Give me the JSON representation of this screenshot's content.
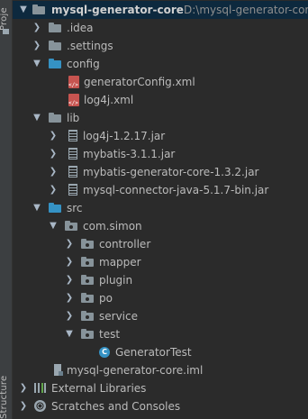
{
  "side_tool_window": {
    "top_label": "Proje",
    "bottom_label": "Structure"
  },
  "tree": {
    "root": {
      "name": "mysql-generator-core",
      "path": "D:\\mysql-generator-cor"
    },
    "idea": ".idea",
    "settings": ".settings",
    "config": {
      "name": "config",
      "files": [
        "generatorConfig.xml",
        "log4j.xml"
      ]
    },
    "lib": {
      "name": "lib",
      "jars": [
        "log4j-1.2.17.jar",
        "mybatis-3.1.1.jar",
        "mybatis-generator-core-1.3.2.jar",
        "mysql-connector-java-5.1.7-bin.jar"
      ]
    },
    "src": {
      "name": "src",
      "package": "com.simon",
      "subpackages": [
        "controller",
        "mapper",
        "plugin",
        "po",
        "service",
        "test"
      ],
      "test_class": "GeneratorTest"
    },
    "iml": "mysql-generator-core.iml",
    "external_libraries": "External Libraries",
    "scratches": "Scratches and Consoles"
  },
  "colors": {
    "background": "#2b2b2b",
    "selection": "#0d293e",
    "folder_blue": "#3592c4",
    "folder_gray": "#87939a",
    "text": "#bbbbbb"
  }
}
